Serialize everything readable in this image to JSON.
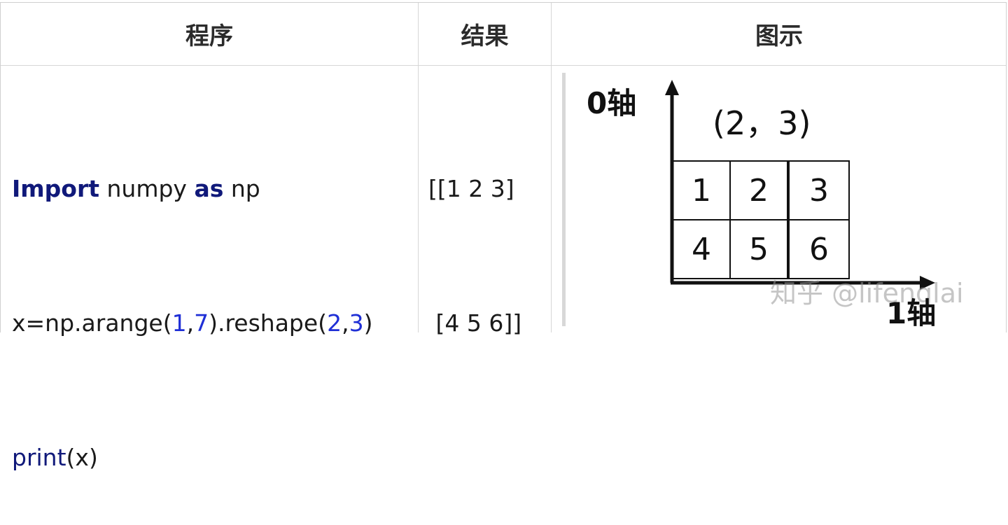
{
  "headers": {
    "program": "程序",
    "result": "结果",
    "diagram": "图示"
  },
  "code": {
    "line1": {
      "kw1": "Import",
      "mid": " numpy ",
      "kw2": "as",
      "end": " np"
    },
    "line2": {
      "a": "x=np.arange(",
      "n1": "1",
      "comma1": ",",
      "n2": "7",
      "b": ").reshape(",
      "n3": "2",
      "comma2": ",",
      "n4": "3",
      "c": ")"
    },
    "line3": {
      "fn": "print",
      "rest": "(x)"
    }
  },
  "result": {
    "line1": "[[1 2 3]",
    "line2": " [4 5 6]]"
  },
  "diagram": {
    "axis0_label": "0轴",
    "axis1_label": "1轴",
    "shape_label": "(2，3)",
    "cells": [
      "1",
      "2",
      "3",
      "4",
      "5",
      "6"
    ]
  },
  "watermark": "知乎 @lifenglai"
}
